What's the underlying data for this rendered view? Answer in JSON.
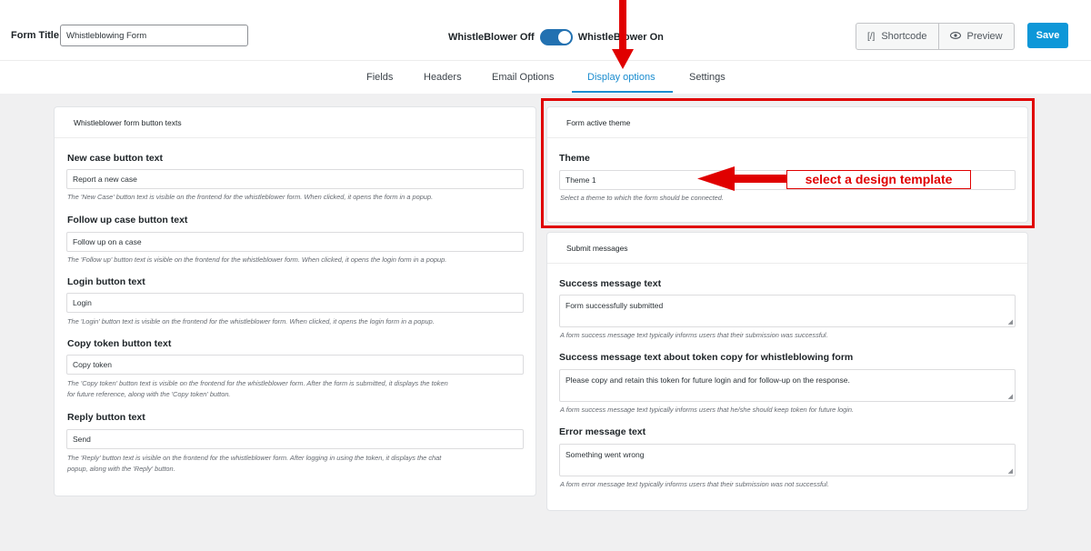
{
  "header": {
    "form_title_label": "Form Title",
    "form_title_value": "Whistleblowing Form",
    "toggle_off_label": "WhistleBlower Off",
    "toggle_on_label": "WhistleBlower On",
    "toggle_state": "on",
    "shortcode_label": "Shortcode",
    "shortcode_icon": "[/]",
    "preview_label": "Preview",
    "preview_icon": "eye-icon",
    "save_label": "Save"
  },
  "tabs": {
    "fields": "Fields",
    "headers": "Headers",
    "email_options": "Email Options",
    "display_options": "Display options",
    "settings": "Settings",
    "active": "display_options"
  },
  "left_panel": {
    "title": "Whistleblower form button texts",
    "new_case": {
      "label": "New case button text",
      "value": "Report a new case",
      "help": "The 'New Case' button text is visible on the frontend for the whistleblower form. When clicked, it opens the form in a popup."
    },
    "follow_up": {
      "label": "Follow up case button text",
      "value": "Follow up on a case",
      "help": "The 'Follow up' button text is visible on the frontend for the whistleblower form. When clicked, it opens the login form in a popup."
    },
    "login": {
      "label": "Login button text",
      "value": "Login",
      "help": "The 'Login' button text is visible on the frontend for the whistleblower form. When clicked, it opens the login form in a popup."
    },
    "copy_token": {
      "label": "Copy token button text",
      "value": "Copy token",
      "help_line1": "The 'Copy token' button text is visible on the frontend for the whistleblower form. After the form is submitted, it displays the token",
      "help_line2": "for future reference, along with the 'Copy token' button."
    },
    "reply": {
      "label": "Reply button text",
      "value": "Send",
      "help_line1": "The 'Reply' button text is visible on the frontend for the whistleblower form. After logging in using the token, it displays the chat",
      "help_line2": "popup, along with the 'Reply' button."
    }
  },
  "theme_panel": {
    "title": "Form active theme",
    "theme_label": "Theme",
    "theme_value": "Theme 1",
    "theme_help": "Select a theme to which the form should be connected."
  },
  "submit_panel": {
    "title": "Submit messages",
    "success": {
      "label": "Success message text",
      "value": "Form successfully submitted",
      "help": "A form success message text typically informs users that their submission was successful."
    },
    "token_copy": {
      "label": "Success message text about token copy for whistleblowing form",
      "value": "Please copy and retain this token for future login and for follow-up on the response.",
      "help": "A form success message text typically informs users that he/she should keep token for future login."
    },
    "error": {
      "label": "Error message text",
      "value": "Something went wrong",
      "help": "A form error message text typically informs users that their submission was not successful."
    }
  },
  "annotations": {
    "callout_text": "select a design template",
    "highlight_color": "#e00000"
  },
  "colors": {
    "accent": "#1a8ccf",
    "save_button": "#0e97d8",
    "toggle": "#2271b1"
  }
}
